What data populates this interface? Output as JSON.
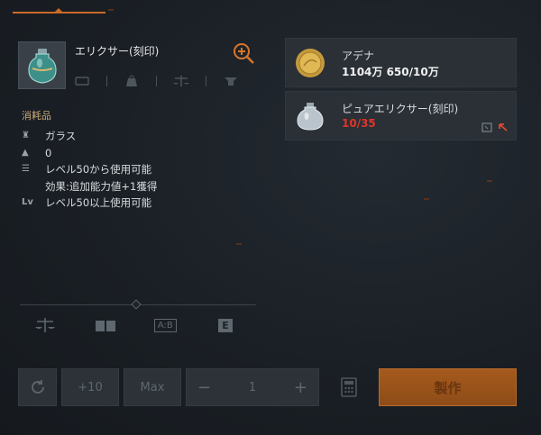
{
  "item": {
    "name": "エリクサー(刻印)",
    "category": "消耗品",
    "properties": [
      {
        "icon": "material-icon",
        "text": "ガラス"
      },
      {
        "icon": "weight-icon",
        "text": "0"
      },
      {
        "icon": "list-icon",
        "text": "レベル50から使用可能"
      },
      {
        "icon": "",
        "text": "効果:追加能力値+1獲得"
      },
      {
        "icon": "level-icon",
        "text": "レベル50以上使用可能"
      }
    ]
  },
  "materials": [
    {
      "name": "アデナ",
      "amount": "1104万 650/10万",
      "short": false,
      "icon": "adena-coin-icon"
    },
    {
      "name": "ピュアエリクサー(刻印)",
      "amount": "10/35",
      "short": true,
      "icon": "pure-elixir-icon"
    }
  ],
  "controls": {
    "plus10": "+10",
    "max": "Max",
    "minus": "−",
    "quantity": "1",
    "plus": "+",
    "craft": "製作"
  },
  "bottom_tabs": [
    "A:B",
    "E"
  ],
  "colors": {
    "accent": "#c96a28",
    "shortage": "#e0342a",
    "craft": "#9a521a"
  }
}
